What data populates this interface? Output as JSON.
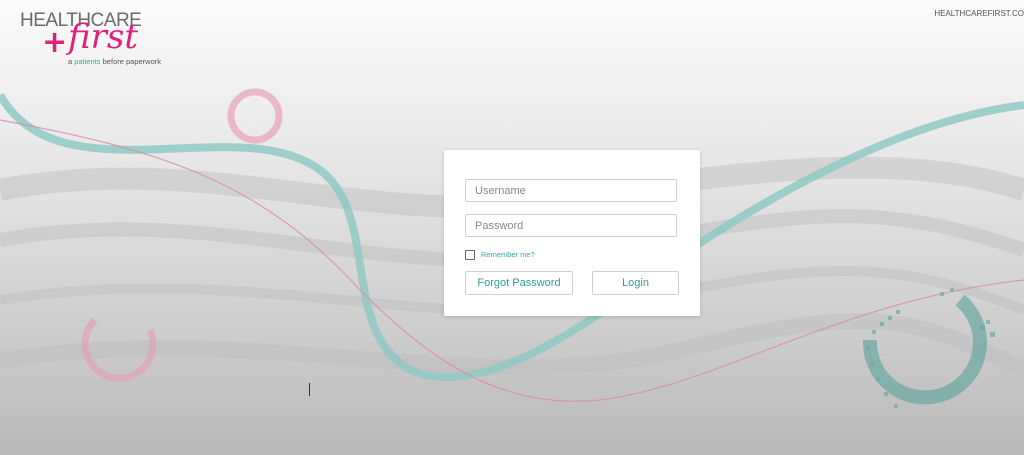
{
  "logo": {
    "word_top": "HEALTHCARE",
    "plus": "+",
    "word_script": "first",
    "tagline_prefix": "a",
    "tagline_accent": "patients",
    "tagline_rest": "before paperwork"
  },
  "header": {
    "site_link": "HEALTHCAREFIRST.CO"
  },
  "login": {
    "username_placeholder": "Username",
    "username_value": "",
    "password_placeholder": "Password",
    "password_value": "",
    "remember_label": "Remember me?",
    "remember_checked": false,
    "forgot_label": "Forgot Password",
    "login_label": "Login"
  },
  "colors": {
    "brand_pink": "#e0217a",
    "brand_teal": "#3aa8a0",
    "background": "#d9d9d9",
    "card": "#ffffff"
  },
  "icons": {
    "remember_checkbox": "checkbox-unchecked-icon"
  }
}
